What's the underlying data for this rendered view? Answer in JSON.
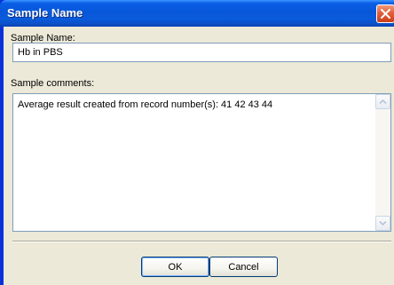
{
  "window": {
    "title": "Sample Name"
  },
  "form": {
    "name_label": "Sample Name:",
    "name_value": "Hb in PBS",
    "comments_label": "Sample comments:",
    "comments_value": "Average result created from record number(s): 41 42 43 44"
  },
  "buttons": {
    "ok_label": "OK",
    "cancel_label": "Cancel"
  },
  "icons": {
    "close": "close-icon",
    "scroll_up": "scroll-up-arrow-icon",
    "scroll_down": "scroll-down-arrow-icon"
  }
}
